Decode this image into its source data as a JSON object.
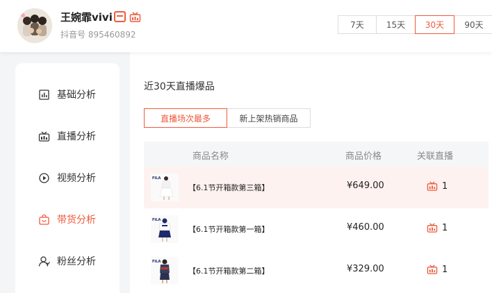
{
  "profile": {
    "name": "王婉霏vivi",
    "douyin_id": "抖音号 895460892",
    "badges": [
      "tv-icon",
      "live-icon"
    ]
  },
  "date_range": {
    "options": [
      "7天",
      "15天",
      "30天",
      "90天"
    ],
    "selected": "30天"
  },
  "sidebar": {
    "items": [
      {
        "label": "基础分析",
        "icon": "bar-chart-icon"
      },
      {
        "label": "直播分析",
        "icon": "live-icon"
      },
      {
        "label": "视频分析",
        "icon": "play-circle-icon"
      },
      {
        "label": "带货分析",
        "icon": "shopping-bag-icon",
        "active": true
      },
      {
        "label": "粉丝分析",
        "icon": "user-icon"
      }
    ]
  },
  "main": {
    "title": "近30天直播爆品",
    "tabs": [
      {
        "label": "直播场次最多",
        "active": true
      },
      {
        "label": "新上架热销商品",
        "active": false
      }
    ],
    "table": {
      "headers": {
        "name": "商品名称",
        "price": "商品价格",
        "live": "关联直播"
      },
      "rows": [
        {
          "name": "【6.1节开箱款第三箱】",
          "price": "¥649.00",
          "live_count": "1",
          "thumb_brand": "FILA",
          "highlight": true
        },
        {
          "name": "【6.1节开箱款第一箱】",
          "price": "¥460.00",
          "live_count": "1",
          "thumb_brand": "FILA",
          "highlight": false
        },
        {
          "name": "【6.1节开箱款第二箱】",
          "price": "¥329.00",
          "live_count": "1",
          "thumb_brand": "FILA",
          "highlight": false
        }
      ]
    }
  },
  "colors": {
    "accent": "#ee5a3a",
    "highlight_row": "#fef2f0",
    "header_bg": "#f5f6f8"
  }
}
